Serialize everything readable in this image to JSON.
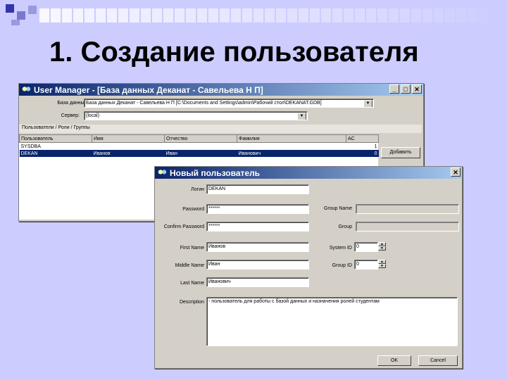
{
  "slide": {
    "title": "1.  Создание пользователя"
  },
  "colors": {
    "slide_bg": "#ccccff",
    "deco_square": "#3333aa",
    "title_grad_start": "#0a246a",
    "title_grad_end": "#a6caf0",
    "selection": "#0a246a"
  },
  "main_window": {
    "title": "User Manager - [База данных Деканат - Савельева Н П]",
    "db_label": "База данных:",
    "db_value": "База данных Деканат - Савельева Н П [C:\\Documents and Settings\\admin\\Рабочий стол\\DEKANAT.GDB]",
    "server_label": "Сервер:",
    "server_value": "(local)",
    "tab_label": "Пользователи / Роли / Группы",
    "columns": [
      "Пользователь",
      "Имя",
      "Отчество",
      "Фамилия",
      "AC"
    ],
    "rows": [
      {
        "cells": [
          "SYSDBA",
          "",
          "",
          "",
          "1"
        ],
        "selected": false
      },
      {
        "cells": [
          "DEKAN",
          "Иванов",
          "Иван",
          "Иванович",
          "0"
        ],
        "selected": true
      }
    ],
    "add_button": "Добавить"
  },
  "dialog": {
    "title": "Новый пользователь",
    "login_label": "Логин",
    "login_value": "DEKAN",
    "password_label": "Password",
    "password_value": "******",
    "confirm_label": "Confirm Password",
    "confirm_value": "******",
    "first_label": "First Name",
    "first_value": "Иванов",
    "middle_label": "Middle Name",
    "middle_value": "Иван",
    "last_label": "Last Name",
    "last_value": "Иванович",
    "desc_label": "Description",
    "desc_value": "- пользователь для работы с базой данных и назначения ролей студентам",
    "group_name_label": "Group Name",
    "group_name_value": "",
    "group_label": "Group",
    "group_value": "",
    "system_label": "System ID",
    "system_value": "0",
    "gid_label": "Group ID",
    "gid_value": "0",
    "ok_button": "OK",
    "cancel_button": "Cancel"
  }
}
